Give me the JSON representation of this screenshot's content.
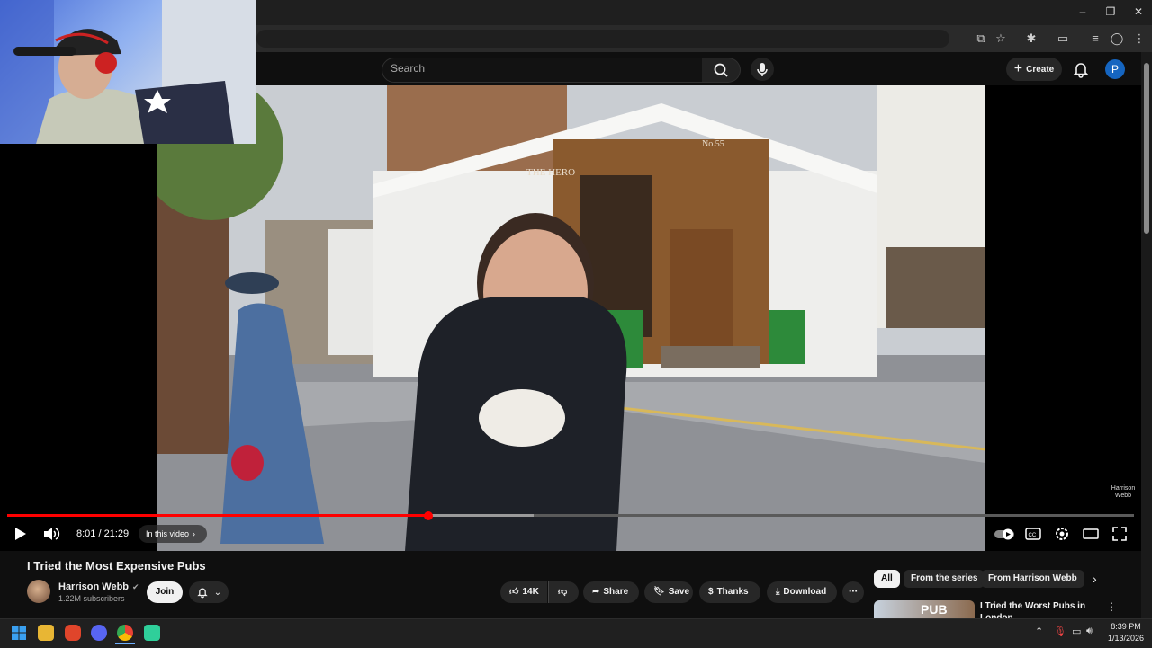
{
  "window": {
    "minimize": "–",
    "restore": "❐",
    "close": "✕"
  },
  "search": {
    "placeholder": "Search"
  },
  "header": {
    "create_label": "Create",
    "avatar_letter": "P"
  },
  "player": {
    "time": "8:01 / 21:29",
    "in_this_video": "In this video",
    "progress_played_fraction": 0.374,
    "progress_buffered_fraction": 0.467,
    "watermark": "Harrison\nWebb",
    "scene_signs": {
      "pub_name": "THE HERO",
      "number": "No.55"
    }
  },
  "video": {
    "title": "I Tried the Most Expensive Pubs",
    "channel": "Harrison Webb",
    "subscribers": "1.22M subscribers",
    "join_label": "Join",
    "likes": "14K",
    "share_label": "Share",
    "save_label": "Save",
    "thanks_label": "Thanks",
    "download_label": "Download"
  },
  "chips": [
    "All",
    "From the series",
    "From Harrison Webb"
  ],
  "recommendation": {
    "thumb_text": "PUB",
    "title": "I Tried the Worst Pubs in London"
  },
  "taskbar": {
    "time": "8:39 PM",
    "date": "1/13/2026"
  },
  "colors": {
    "accent_red": "#ff0000",
    "avatar_blue": "#1565c0",
    "bg": "#0f0f0f"
  }
}
